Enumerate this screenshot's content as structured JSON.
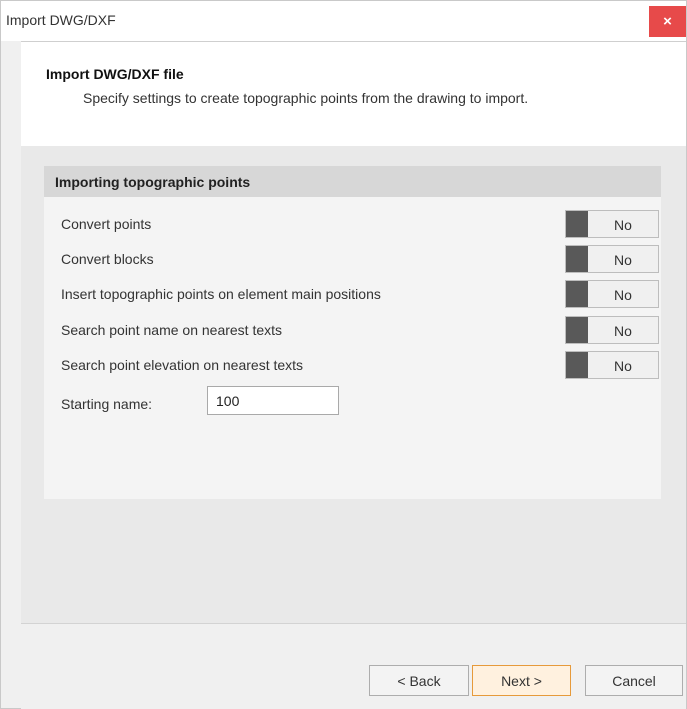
{
  "window": {
    "title": "Import DWG/DXF",
    "close_icon": "×"
  },
  "header": {
    "title": "Import DWG/DXF file",
    "description": "Specify settings to create topographic points from the drawing to import."
  },
  "section": {
    "title": "Importing topographic points",
    "options": [
      {
        "label": "Convert points",
        "value": "No"
      },
      {
        "label": "Convert blocks",
        "value": "No"
      },
      {
        "label": "Insert topographic points on element main positions",
        "value": "No"
      },
      {
        "label": "Search point name on nearest texts",
        "value": "No"
      },
      {
        "label": "Search point elevation on nearest texts",
        "value": "No"
      }
    ],
    "starting_name": {
      "label": "Starting name:",
      "value": "100"
    }
  },
  "buttons": {
    "back": "< Back",
    "next": "Next >",
    "cancel": "Cancel"
  },
  "colors": {
    "close": "#e74a4a",
    "next_accent": "#e69a3b",
    "toggle_off": "#595959"
  }
}
